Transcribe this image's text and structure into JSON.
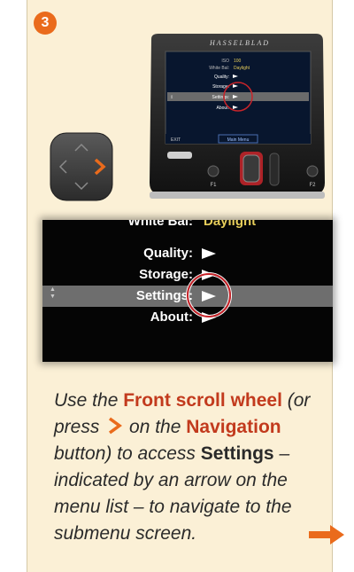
{
  "step": {
    "number": "3"
  },
  "camera": {
    "brand": "HASSELBLAD",
    "screen": {
      "iso": "ISO",
      "iso_value": "100",
      "white_bal_label": "White Bal:",
      "white_bal_value": "Daylight",
      "items": [
        "Quality:",
        "Storage:",
        "Settings:",
        "About:"
      ],
      "exit_label": "EXIT",
      "main_menu_label": "Main Menu"
    },
    "buttons": {
      "left": "F1",
      "right": "F2"
    }
  },
  "zoom_menu": {
    "partial_label": "White Bal:",
    "partial_value": "Daylight",
    "items": [
      {
        "label": "Quality:",
        "selected": false
      },
      {
        "label": "Storage:",
        "selected": false
      },
      {
        "label": "Settings:",
        "selected": true
      },
      {
        "label": "About:",
        "selected": false
      }
    ],
    "up_glyph": "▲",
    "down_glyph": "▼"
  },
  "description": {
    "part1": "Use the ",
    "front_scroll_wheel": "Front scroll wheel",
    "part2": " (or press ",
    "part3": " on the ",
    "navigation": "Navigation",
    "part4": " button) to access ",
    "settings": "Settings",
    "part5": " – indicated by an arrow on the menu list – to navigate to the submenu screen."
  },
  "colors": {
    "accent": "#ea6b1c",
    "highlight_text": "#c23a1d",
    "card_background": "#fbf0d6",
    "selection_ring": "#c8242a",
    "menu_value_yellow": "#e6cd5a"
  },
  "icons": {
    "nav_right": "chevron-right-icon",
    "next_page": "arrow-right-icon"
  }
}
